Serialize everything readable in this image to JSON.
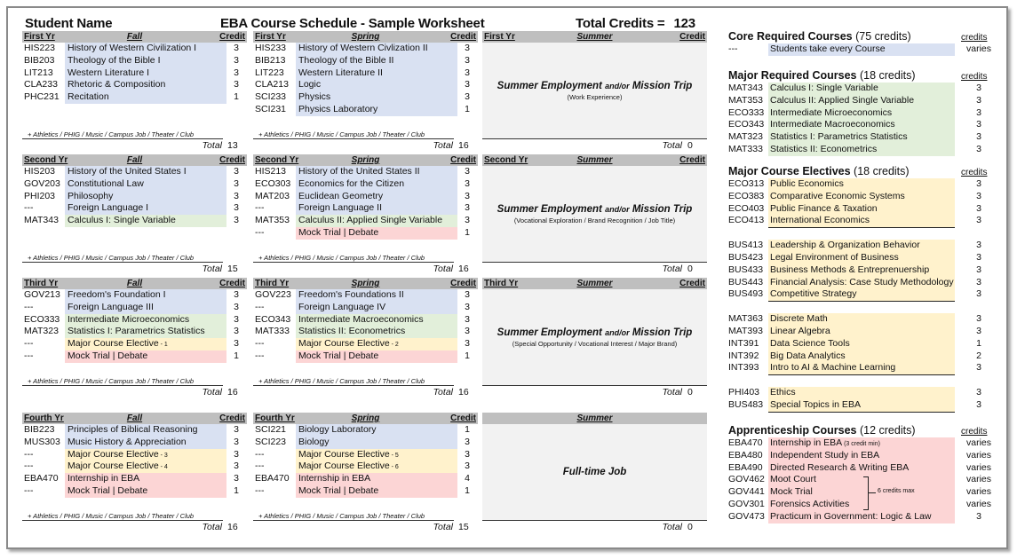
{
  "header": {
    "student_name": "Student Name",
    "schedule_title": "EBA Course Schedule - Sample Worksheet",
    "total_credits_label": "Total Credits =",
    "total_credits_value": "123"
  },
  "extras_text": "+ Athletics / PHIG / Music / Campus Job / Theater / Club",
  "total_label": "Total",
  "years": [
    {
      "fall": {
        "year_label": "First Yr",
        "season": "Fall",
        "credit_label": "Credit",
        "total": "13",
        "courses": [
          {
            "code": "HIS223",
            "name": "History of Western Civilization I",
            "credit": "3",
            "type": "core"
          },
          {
            "code": "BIB203",
            "name": "Theology of the Bible I",
            "credit": "3",
            "type": "core"
          },
          {
            "code": "LIT213",
            "name": "Western Literature I",
            "credit": "3",
            "type": "core"
          },
          {
            "code": "CLA233",
            "name": "Rhetoric & Composition",
            "credit": "3",
            "type": "core"
          },
          {
            "code": "PHC231",
            "name": "Recitation",
            "credit": "1",
            "type": "core"
          }
        ]
      },
      "spring": {
        "year_label": "First Yr",
        "season": "Spring",
        "credit_label": "Credit",
        "total": "16",
        "courses": [
          {
            "code": "HIS233",
            "name": "History of Western Civlization II",
            "credit": "3",
            "type": "core"
          },
          {
            "code": "BIB213",
            "name": "Theology of the Bible II",
            "credit": "3",
            "type": "core"
          },
          {
            "code": "LIT223",
            "name": "Western Literature II",
            "credit": "3",
            "type": "core"
          },
          {
            "code": "CLA213",
            "name": "Logic",
            "credit": "3",
            "type": "core"
          },
          {
            "code": "SCI233",
            "name": "Physics",
            "credit": "3",
            "type": "core"
          },
          {
            "code": "SCI231",
            "name": "Physics Laboratory",
            "credit": "1",
            "type": "core"
          }
        ]
      },
      "summer": {
        "year_label": "First Yr",
        "season": "Summer",
        "credit_label": "Credit",
        "total": "0",
        "main_a": "Summer Employment",
        "and_or": "and/or",
        "main_b": "Mission Trip",
        "sub": "(Work Experience)"
      }
    },
    {
      "fall": {
        "year_label": "Second Yr",
        "season": "Fall",
        "credit_label": "Credit",
        "total": "15",
        "courses": [
          {
            "code": "HIS203",
            "name": "History of the United States I",
            "credit": "3",
            "type": "core"
          },
          {
            "code": "GOV203",
            "name": "Constitutional Law",
            "credit": "3",
            "type": "core"
          },
          {
            "code": "PHI203",
            "name": "Philosophy",
            "credit": "3",
            "type": "core"
          },
          {
            "code": "---",
            "name": "Foreign Language I",
            "credit": "3",
            "type": "core"
          },
          {
            "code": "MAT343",
            "name": "Calculus I:  Single Variable",
            "credit": "3",
            "type": "major"
          }
        ]
      },
      "spring": {
        "year_label": "Second Yr",
        "season": "Spring",
        "credit_label": "Credit",
        "total": "16",
        "courses": [
          {
            "code": "HIS213",
            "name": "History of the United States II",
            "credit": "3",
            "type": "core"
          },
          {
            "code": "ECO303",
            "name": "Economics for the Citizen",
            "credit": "3",
            "type": "core"
          },
          {
            "code": "MAT203",
            "name": "Euclidean Geometry",
            "credit": "3",
            "type": "core"
          },
          {
            "code": "---",
            "name": "Foreign Language II",
            "credit": "3",
            "type": "core"
          },
          {
            "code": "MAT353",
            "name": "Calculus II: Applied Single Variable",
            "credit": "3",
            "type": "major"
          },
          {
            "code": "---",
            "name": "Mock Trial | Debate",
            "credit": "1",
            "type": "appr"
          }
        ]
      },
      "summer": {
        "year_label": "Second Yr",
        "season": "Summer",
        "credit_label": "Credit",
        "total": "0",
        "main_a": "Summer Employment",
        "and_or": "and/or",
        "main_b": "Mission Trip",
        "sub": "(Vocational Exploration / Brand Recognition / Job Title)"
      }
    },
    {
      "fall": {
        "year_label": "Third Yr",
        "season": "Fall",
        "credit_label": "Credit",
        "total": "16",
        "courses": [
          {
            "code": "GOV213",
            "name": "Freedom's Foundation I",
            "credit": "3",
            "type": "core"
          },
          {
            "code": "---",
            "name": "Foreign Language III",
            "credit": "3",
            "type": "core"
          },
          {
            "code": "ECO333",
            "name": "Intermediate Microeconomics",
            "credit": "3",
            "type": "major"
          },
          {
            "code": "MAT323",
            "name": "Statistics I:  Parametrics Statistics",
            "credit": "3",
            "type": "major"
          },
          {
            "code": "---",
            "name": "Major Course Elective",
            "suffix": " - 1",
            "credit": "3",
            "type": "elective"
          },
          {
            "code": "---",
            "name": "Mock Trial | Debate",
            "credit": "1",
            "type": "appr"
          }
        ]
      },
      "spring": {
        "year_label": "Third Yr",
        "season": "Spring",
        "credit_label": "Credit",
        "total": "16",
        "courses": [
          {
            "code": "GOV223",
            "name": "Freedom's Foundations II",
            "credit": "3",
            "type": "core"
          },
          {
            "code": "---",
            "name": "Foreign Language IV",
            "credit": "3",
            "type": "core"
          },
          {
            "code": "ECO343",
            "name": "Intermediate Macroeconomics",
            "credit": "3",
            "type": "major"
          },
          {
            "code": "MAT333",
            "name": "Statistics II:  Econometrics",
            "credit": "3",
            "type": "major"
          },
          {
            "code": "---",
            "name": "Major Course Elective",
            "suffix": " - 2",
            "credit": "3",
            "type": "elective"
          },
          {
            "code": "---",
            "name": "Mock Trial | Debate",
            "credit": "1",
            "type": "appr"
          }
        ]
      },
      "summer": {
        "year_label": "Third Yr",
        "season": "Summer",
        "credit_label": "Credit",
        "total": "0",
        "main_a": "Summer Employment",
        "and_or": "and/or",
        "main_b": "Mission Trip",
        "sub": "(Special Opportunity / Vocational Interest / Major Brand)"
      }
    },
    {
      "fall": {
        "year_label": "Fourth Yr",
        "season": "Fall",
        "credit_label": "Credit",
        "total": "16",
        "courses": [
          {
            "code": "BIB223",
            "name": "Principles of Biblical Reasoning",
            "credit": "3",
            "type": "core"
          },
          {
            "code": "MUS303",
            "name": "Music History & Appreciation",
            "credit": "3",
            "type": "core"
          },
          {
            "code": "---",
            "name": "Major Course Elective",
            "suffix": " - 3",
            "credit": "3",
            "type": "elective"
          },
          {
            "code": "---",
            "name": "Major Course Elective",
            "suffix": " - 4",
            "credit": "3",
            "type": "elective"
          },
          {
            "code": "EBA470",
            "name": "Internship in EBA",
            "credit": "3",
            "type": "appr"
          },
          {
            "code": "---",
            "name": "Mock Trial | Debate",
            "credit": "1",
            "type": "appr"
          }
        ]
      },
      "spring": {
        "year_label": "Fourth Yr",
        "season": "Spring",
        "credit_label": "Credit",
        "total": "15",
        "courses": [
          {
            "code": "SCI221",
            "name": "Biology Laboratory",
            "credit": "1",
            "type": "core"
          },
          {
            "code": "SCI223",
            "name": "Biology",
            "credit": "3",
            "type": "core"
          },
          {
            "code": "---",
            "name": "Major Course Elective",
            "suffix": " - 5",
            "credit": "3",
            "type": "elective"
          },
          {
            "code": "---",
            "name": "Major Course Elective",
            "suffix": " - 6",
            "credit": "3",
            "type": "elective"
          },
          {
            "code": "EBA470",
            "name": "Internship in EBA",
            "credit": "4",
            "type": "appr"
          },
          {
            "code": "---",
            "name": "Mock Trial | Debate",
            "credit": "1",
            "type": "appr"
          }
        ]
      },
      "summer": {
        "year_label": "",
        "season": "Summer",
        "credit_label": "",
        "total": "0",
        "main_a": "Full-time Job",
        "and_or": "",
        "main_b": "",
        "sub": ""
      }
    }
  ],
  "categories": {
    "credits_label": "credits",
    "core": {
      "title": "Core Required Courses",
      "paren": "(75 credits)",
      "items": [
        {
          "code": "---",
          "name": "Students take every Course",
          "credit": "varies"
        }
      ]
    },
    "major": {
      "title": "Major Required Courses",
      "paren": "(18 credits)",
      "items": [
        {
          "code": "MAT343",
          "name": "Calculus I:  Single Variable",
          "credit": "3"
        },
        {
          "code": "MAT353",
          "name": "Calculus II: Applied Single Variable",
          "credit": "3"
        },
        {
          "code": "ECO333",
          "name": "Intermediate Microeconomics",
          "credit": "3"
        },
        {
          "code": "ECO343",
          "name": "Intermediate Macroeconomics",
          "credit": "3"
        },
        {
          "code": "MAT323",
          "name": "Statistics I:  Parametrics Statistics",
          "credit": "3"
        },
        {
          "code": "MAT333",
          "name": "Statistics II:  Econometrics",
          "credit": "3"
        }
      ]
    },
    "electives": {
      "title": "Major Course Electives",
      "paren": "(18 credits)",
      "groups": [
        [
          {
            "code": "ECO313",
            "name": "Public Economics",
            "credit": "3"
          },
          {
            "code": "ECO383",
            "name": "Comparative Economic Systems",
            "credit": "3"
          },
          {
            "code": "ECO403",
            "name": "Public Finance & Taxation",
            "credit": "3"
          },
          {
            "code": "ECO413",
            "name": "International Economics",
            "credit": "3"
          }
        ],
        [
          {
            "code": "BUS413",
            "name": "Leadership & Organization Behavior",
            "credit": "3"
          },
          {
            "code": "BUS423",
            "name": "Legal Environment of Business",
            "credit": "3"
          },
          {
            "code": "BUS433",
            "name": "Business Methods & Entreprenuership",
            "credit": "3"
          },
          {
            "code": "BUS443",
            "name": "Financial Analysis: Case Study Methodology",
            "credit": "3"
          },
          {
            "code": "BUS493",
            "name": "Competitive Strategy",
            "credit": "3"
          }
        ],
        [
          {
            "code": "MAT363",
            "name": "Discrete Math",
            "credit": "3"
          },
          {
            "code": "MAT393",
            "name": "Linear Algebra",
            "credit": "3"
          },
          {
            "code": "INT391",
            "name": "Data Science Tools",
            "credit": "1"
          },
          {
            "code": "INT392",
            "name": "Big Data Analytics",
            "credit": "2"
          },
          {
            "code": "INT393",
            "name": "Intro to AI & Machine Learning",
            "credit": "3"
          }
        ],
        [
          {
            "code": "PHI403",
            "name": "Ethics",
            "credit": "3"
          },
          {
            "code": "BUS483",
            "name": "Special Topics in EBA",
            "credit": "3"
          }
        ]
      ]
    },
    "apprenticeship": {
      "title": "Apprenticeship Courses",
      "paren": "(12 credits)",
      "items": [
        {
          "code": "EBA470",
          "name": "Internship in EBA",
          "note": " (3 credit min)",
          "credit": "varies"
        },
        {
          "code": "EBA480",
          "name": "Independent Study in EBA",
          "credit": "varies"
        },
        {
          "code": "EBA490",
          "name": "Directed Research & Writing EBA",
          "credit": "varies"
        },
        {
          "code": "GOV462",
          "name": "Moot Court",
          "credit": "varies"
        },
        {
          "code": "GOV441",
          "name": "Mock Trial",
          "credit": "varies"
        },
        {
          "code": "GOV301",
          "name": "Forensics Activities",
          "credit": "varies"
        },
        {
          "code": "GOV473",
          "name": "Practicum in Government: Logic & Law",
          "credit": "3"
        }
      ],
      "bracket_label": "6 credits max"
    }
  },
  "colors": {
    "core": "#d9e1f2",
    "major": "#e2efda",
    "elective": "#fff2cc",
    "apprenticeship": "#fcd5d5",
    "header_gray": "#bfbfbf",
    "summer_gray": "#f2f2f2"
  }
}
